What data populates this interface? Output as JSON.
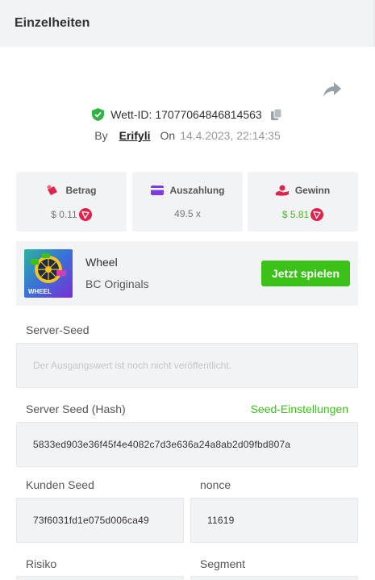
{
  "header": {
    "title": "Einzelheiten"
  },
  "bet": {
    "id_label": "Wett-ID:",
    "id_value": "17077064846814563",
    "by_label": "By",
    "user": "Erifyli",
    "on_label": "On",
    "date": "14.4.2023, 22:14:35"
  },
  "stats": [
    {
      "label": "Betrag",
      "value": "$ 0.11",
      "icon": "bag-icon"
    },
    {
      "label": "Auszahlung",
      "value": "49.5 x",
      "icon": "card-icon"
    },
    {
      "label": "Gewinn",
      "value": "$ 5.81",
      "icon": "hand-coin-icon"
    }
  ],
  "game": {
    "name": "Wheel",
    "provider": "BC Originals",
    "thumb_text": "WHEEL",
    "play_label": "Jetzt spielen"
  },
  "fields": {
    "server_seed": {
      "label": "Server-Seed",
      "placeholder": "Der Ausgangswert ist noch nicht veröffentlicht."
    },
    "server_hash": {
      "label": "Server Seed (Hash)",
      "link": "Seed-Einstellungen",
      "value": "5833ed903e36f45f4e4082c7d3e636a24a8ab2d09fbd807a"
    },
    "client_seed": {
      "label": "Kunden Seed",
      "value": "73f6031fd1e075d006ca49"
    },
    "nonce": {
      "label": "nonce",
      "value": "11619"
    },
    "risk": {
      "label": "Risiko"
    },
    "segment": {
      "label": "Segment"
    }
  },
  "colors": {
    "accent_green": "#3bc117",
    "coin_red": "#e0234a",
    "panel_bg": "#f2f3f5"
  }
}
